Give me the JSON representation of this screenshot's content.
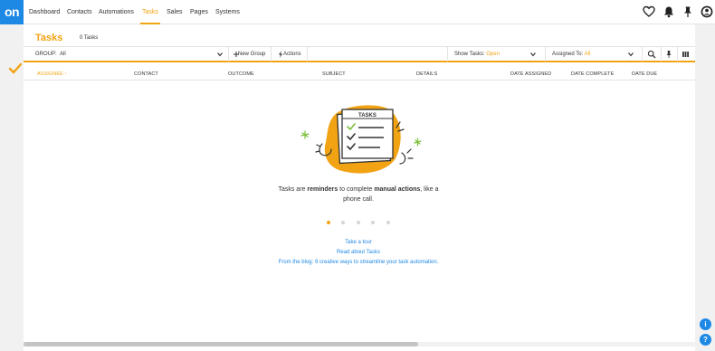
{
  "nav": {
    "logo": "on",
    "items": [
      {
        "label": "Dashboard",
        "active": false
      },
      {
        "label": "Contacts",
        "active": false
      },
      {
        "label": "Automations",
        "active": false
      },
      {
        "label": "Tasks",
        "active": true
      },
      {
        "label": "Sales",
        "active": false
      },
      {
        "label": "Pages",
        "active": false
      },
      {
        "label": "Systems",
        "active": false
      }
    ],
    "icons": [
      "heart-icon",
      "bell-icon",
      "pin-icon",
      "user-account-icon"
    ]
  },
  "page": {
    "title": "Tasks",
    "count": "0 Tasks"
  },
  "filterbar": {
    "group_label": "GROUP:",
    "group_value": "All",
    "new_group": "New Group",
    "actions": "Actions",
    "show_tasks_label": "Show Tasks:",
    "show_tasks_value": "Open",
    "assigned_to_label": "Assigned To:",
    "assigned_to_value": "All"
  },
  "columns": [
    "ASSIGNEE",
    "CONTACT",
    "OUTCOME",
    "SUBJECT",
    "DETAILS",
    "DATE ASSIGNED",
    "DATE COMPLETE",
    "DATE DUE"
  ],
  "empty_state": {
    "illustration_label": "TASKS",
    "text_1": "Tasks are ",
    "text_bold_1": "reminders",
    "text_2": " to complete ",
    "text_bold_2": "manual actions",
    "text_3": ", like a phone call.",
    "links": {
      "tour": "Take a tour",
      "read": "Read about Tasks",
      "blog": "From the blog: 9 creative ways to streamline your task automation."
    },
    "carousel_total": 5,
    "carousel_active": 1
  },
  "colors": {
    "accent": "#f2a313",
    "link": "#1e88e5"
  },
  "fabs": {
    "info": "i",
    "help": "?"
  }
}
